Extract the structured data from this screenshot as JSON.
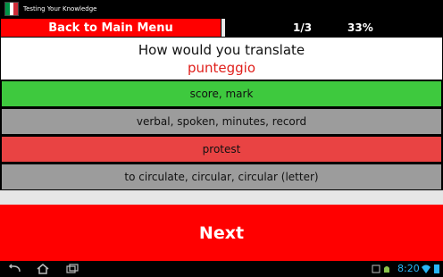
{
  "app": {
    "title": "Testing Your Knowledge",
    "flag_colors": [
      "#009246",
      "#ffffff",
      "#ce2b37"
    ]
  },
  "topbar": {
    "back_label": "Back to Main Menu",
    "progress": "1/3",
    "percent": "33%"
  },
  "question": {
    "prompt": "How would you translate",
    "word": "punteggio"
  },
  "answers": [
    {
      "label": "score, mark",
      "state": "correct"
    },
    {
      "label": "verbal, spoken, minutes, record",
      "state": "neutral"
    },
    {
      "label": "protest",
      "state": "wrong"
    },
    {
      "label": "to circulate, circular, circular (letter)",
      "state": "neutral"
    }
  ],
  "next_label": "Next",
  "system": {
    "time": "8:20",
    "icons": [
      "back-icon",
      "home-icon",
      "recent-apps-icon",
      "gallery-icon",
      "android-icon",
      "wifi-icon",
      "battery-icon"
    ]
  },
  "colors": {
    "accent_red": "#ff0000",
    "correct_green": "#3ec93e",
    "wrong_red": "#e94343",
    "neutral_gray": "#9c9c9c",
    "clock_blue": "#29b6f6"
  }
}
